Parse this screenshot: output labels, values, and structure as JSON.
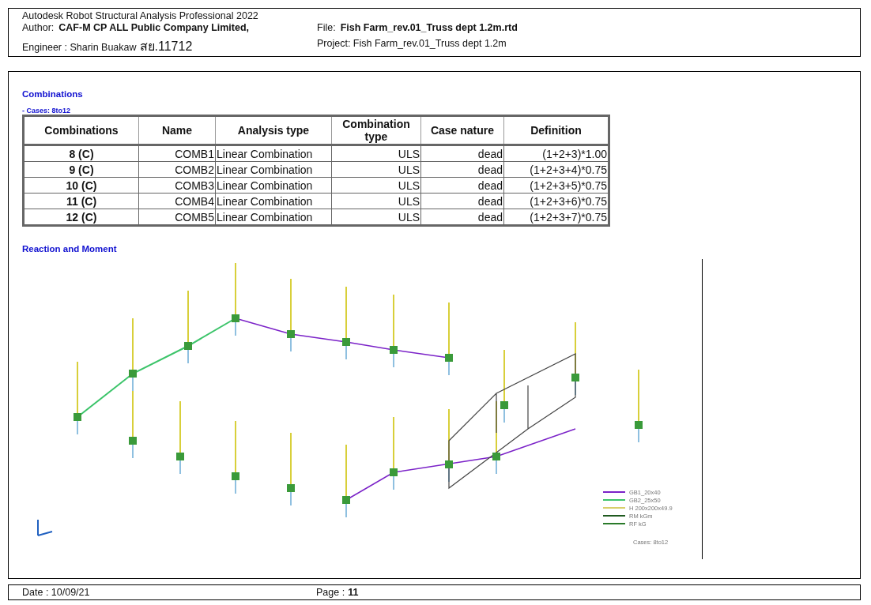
{
  "header": {
    "app": "Autodesk Robot Structural Analysis Professional 2022",
    "author_label": "Author:",
    "author": "CAF-M CP ALL Public Company Limited,",
    "file_label": "File:",
    "file": "Fish Farm_rev.01_Truss dept 1.2m.rtd",
    "engineer_label": "Engineer : Sharin Buakaw",
    "engineer_id": "สย.11712",
    "project": "Project: Fish Farm_rev.01_Truss dept 1.2m"
  },
  "section_title": "Combinations",
  "cases_label": "- Cases:  8to12",
  "table": {
    "columns": [
      "Combinations",
      "Name",
      "Analysis type",
      "Combination type",
      "Case nature",
      "Definition"
    ],
    "rows": [
      [
        "8 (C)",
        "COMB1",
        "Linear Combination",
        "ULS",
        "dead",
        "(1+2+3)*1.00"
      ],
      [
        "9 (C)",
        "COMB2",
        "Linear Combination",
        "ULS",
        "dead",
        "(1+2+3+4)*0.75"
      ],
      [
        "10 (C)",
        "COMB3",
        "Linear Combination",
        "ULS",
        "dead",
        "(1+2+3+5)*0.75"
      ],
      [
        "11 (C)",
        "COMB4",
        "Linear Combination",
        "ULS",
        "dead",
        "(1+2+3+6)*0.75"
      ],
      [
        "12 (C)",
        "COMB5",
        "Linear Combination",
        "ULS",
        "dead",
        "(1+2+3+7)*0.75"
      ]
    ]
  },
  "view_title": "Reaction and Moment",
  "view": {
    "kind": "picture",
    "legend": [
      {
        "label": "GB1_20x40",
        "color": "#7b22c8"
      },
      {
        "label": "GB2_25x50",
        "color": "#3cc46a"
      },
      {
        "label": "H 200x200x49.9",
        "color": "#d8cf6a"
      },
      {
        "label": "RM kGm",
        "color": "#1f5a1f"
      },
      {
        "label": "RF kG",
        "color": "#2a7a2a"
      }
    ],
    "cases": "Cases: 8to12"
  },
  "footer": {
    "date": "Date : 10/09/21",
    "page_label": "Page :",
    "page": "11"
  }
}
